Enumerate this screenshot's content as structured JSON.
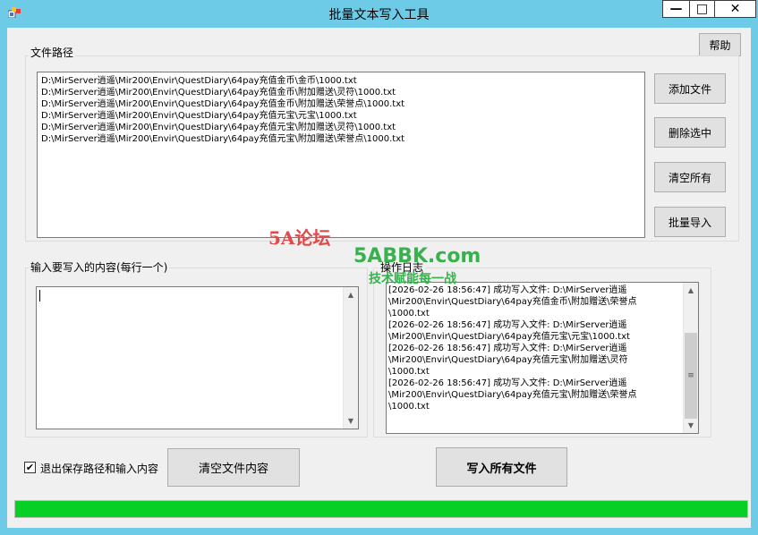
{
  "window": {
    "title": "批量文本写入工具",
    "min_label": "—",
    "max_label": "□",
    "close_label": "✕"
  },
  "help_button": "帮助",
  "file_group": {
    "label": "文件路径",
    "paths": [
      "D:\\MirServer逍遥\\Mir200\\Envir\\QuestDiary\\64pay充值金币\\金币\\1000.txt",
      "D:\\MirServer逍遥\\Mir200\\Envir\\QuestDiary\\64pay充值金币\\附加赠送\\灵符\\1000.txt",
      "D:\\MirServer逍遥\\Mir200\\Envir\\QuestDiary\\64pay充值金币\\附加赠送\\荣誉点\\1000.txt",
      "D:\\MirServer逍遥\\Mir200\\Envir\\QuestDiary\\64pay充值元宝\\元宝\\1000.txt",
      "D:\\MirServer逍遥\\Mir200\\Envir\\QuestDiary\\64pay充值元宝\\附加赠送\\灵符\\1000.txt",
      "D:\\MirServer逍遥\\Mir200\\Envir\\QuestDiary\\64pay充值元宝\\附加赠送\\荣誉点\\1000.txt"
    ],
    "buttons": {
      "add": "添加文件",
      "delete": "删除选中",
      "clear": "清空所有",
      "import": "批量导入"
    }
  },
  "input_group": {
    "label": "输入要写入的内容(每行一个)",
    "value": ""
  },
  "log_group": {
    "label": "操作日志",
    "lines": [
      "[2026-02-26 18:56:47] 成功写入文件: D:\\MirServer逍遥",
      "\\Mir200\\Envir\\QuestDiary\\64pay充值金币\\附加赠送\\荣誉点",
      "\\1000.txt",
      "[2026-02-26 18:56:47] 成功写入文件: D:\\MirServer逍遥",
      "\\Mir200\\Envir\\QuestDiary\\64pay充值元宝\\元宝\\1000.txt",
      "[2026-02-26 18:56:47] 成功写入文件: D:\\MirServer逍遥",
      "\\Mir200\\Envir\\QuestDiary\\64pay充值元宝\\附加赠送\\灵符",
      "\\1000.txt",
      "[2026-02-26 18:56:47] 成功写入文件: D:\\MirServer逍遥",
      "\\Mir200\\Envir\\QuestDiary\\64pay充值元宝\\附加赠送\\荣誉点",
      "\\1000.txt"
    ]
  },
  "bottom": {
    "checkbox_label": "退出保存路径和输入内容",
    "checkbox_checked": true,
    "clear_content_button": "清空文件内容",
    "write_all_button": "写入所有文件",
    "progress": 1.0
  },
  "watermark": {
    "site_cn": "5A论坛",
    "site_en": "5ABBK.com",
    "slogan": "技术赋能每一战"
  },
  "colors": {
    "titlebar": "#6ecbe8",
    "progress_fill": "#06d025"
  }
}
